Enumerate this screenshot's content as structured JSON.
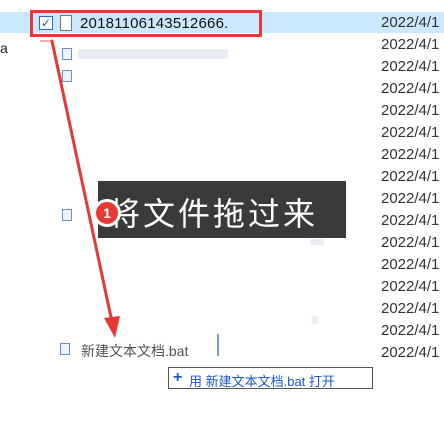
{
  "side_label": "a",
  "selected_file": {
    "name": "20181106143512666.",
    "check_glyph": "✓",
    "date": "2022/4/1"
  },
  "file_icon": "file-icon",
  "rows": [
    {
      "date": "2022/4/1"
    },
    {
      "date": "2022/4/1"
    },
    {
      "date": "2022/4/1"
    },
    {
      "date": "2022/4/1"
    },
    {
      "date": "2022/4/1"
    },
    {
      "date": "2022/4/1"
    },
    {
      "date": "2022/4/1"
    },
    {
      "date": "2022/4/1"
    },
    {
      "date": "2022/4/1"
    },
    {
      "date": "2022/4/1"
    },
    {
      "date": "2022/4/1"
    },
    {
      "date": "2022/4/1"
    },
    {
      "date": "2022/4/1"
    },
    {
      "date": "2022/4/1"
    },
    {
      "date": "2022/4/1"
    }
  ],
  "annotation": {
    "step_number": "1",
    "text": "将文件拖过来"
  },
  "drag_item": {
    "name": "新建文本文档.bat"
  },
  "drop_tooltip": {
    "plus": "+",
    "text": "用 新建文本文档.bat 打开"
  },
  "colors": {
    "highlight": "#e53935",
    "selection": "#cce8ff",
    "banner": "#3a3a3a",
    "link_blue": "#1a57c9"
  }
}
